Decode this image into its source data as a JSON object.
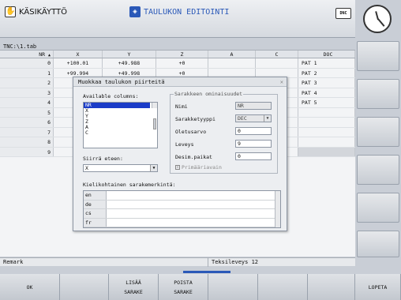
{
  "header": {
    "mode_manual": "KÄSIKÄYTTÖ",
    "mode_edit": "TAULUKON EDITOINTI",
    "dnc_label": "DNC",
    "hand_icon": "hand-icon",
    "edit_icon": "table-edit-icon",
    "colors": {
      "edit_text": "#2b59b8"
    }
  },
  "path": "TNC:\\1.tab",
  "table": {
    "columns": [
      "NR",
      "X",
      "Y",
      "Z",
      "A",
      "C",
      "DOC"
    ],
    "rows": [
      [
        "0",
        "+100.01",
        "+49.988",
        "+0",
        "",
        "",
        "PAT 1"
      ],
      [
        "1",
        "+99.994",
        "+49.998",
        "+0",
        "",
        "",
        "PAT 2"
      ],
      [
        "2",
        "",
        "",
        "",
        "",
        "",
        "PAT 3"
      ],
      [
        "3",
        "",
        "",
        "",
        "",
        "",
        "PAT 4"
      ],
      [
        "4",
        "",
        "",
        "",
        "",
        "",
        "PAT 5"
      ],
      [
        "5",
        "",
        "",
        "",
        "",
        "",
        ""
      ],
      [
        "6",
        "",
        "",
        "",
        "",
        "",
        ""
      ],
      [
        "7",
        "",
        "",
        "",
        "",
        "",
        ""
      ],
      [
        "8",
        "",
        "",
        "",
        "",
        "",
        ""
      ],
      [
        "9",
        "",
        "",
        "",
        "",
        "",
        ""
      ]
    ]
  },
  "status": {
    "remark": "Remark",
    "text_width": "Teksileveys 12"
  },
  "dialog": {
    "title": "Muokkaa taulukon piirteitä",
    "close": "✕",
    "available_label": "Available columns:",
    "columns": [
      "NR",
      "X",
      "Y",
      "Z",
      "A",
      "C"
    ],
    "move_label": "Siirrä eteen:",
    "move_value": "X",
    "props_title": "Sarakkeen ominaisuudet",
    "props": {
      "name_label": "Nimi",
      "name_value": "NR",
      "type_label": "Sarakketyyppi",
      "type_value": "DEC",
      "default_label": "Oletusarvo",
      "default_value": "0",
      "width_label": "Leveys",
      "width_value": "9",
      "decimals_label": "Desim.paikat",
      "decimals_value": "0",
      "primary_label": "Primääriavain"
    },
    "lang_label": "Kielikohtainen sarakemerkintä:",
    "langs": [
      "en",
      "de",
      "cs",
      "fr"
    ]
  },
  "softkeys": [
    {
      "l1": "OK",
      "l2": ""
    },
    {
      "l1": "",
      "l2": ""
    },
    {
      "l1": "LISÄÄ",
      "l2": "SARAKE"
    },
    {
      "l1": "POISTA",
      "l2": "SARAKE"
    },
    {
      "l1": "",
      "l2": ""
    },
    {
      "l1": "",
      "l2": ""
    },
    {
      "l1": "",
      "l2": ""
    },
    {
      "l1": "LOPETA",
      "l2": ""
    }
  ]
}
